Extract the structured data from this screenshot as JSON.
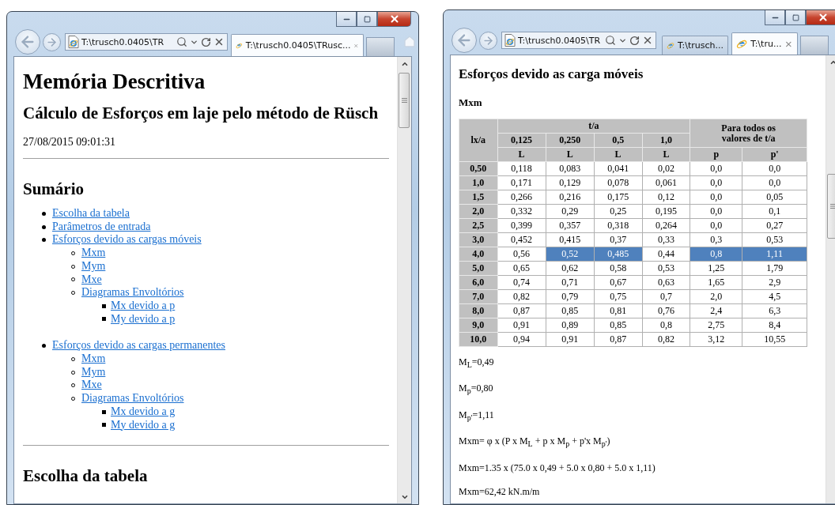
{
  "left_window": {
    "address": "T:\\trusch0.0405\\TR",
    "tabs": [
      {
        "label": "T:\\trusch0.0405\\TRusc...",
        "selected": true
      }
    ],
    "page": {
      "title": "Memória Descritiva",
      "subtitle": "Cálculo de Esforços em laje pelo método de Rüsch",
      "timestamp": "27/08/2015 09:01:31",
      "summary_heading": "Sumário",
      "summary": [
        {
          "label": "Escolha da tabela"
        },
        {
          "label": "Parâmetros de entrada"
        },
        {
          "label": "Esforços devido as cargas móveis",
          "children": [
            {
              "label": "Mxm"
            },
            {
              "label": "Mym"
            },
            {
              "label": "Mxe"
            },
            {
              "label": "Diagramas Envoltórios",
              "children": [
                {
                  "label": "Mx devido a p"
                },
                {
                  "label": "My devido a p"
                }
              ]
            }
          ]
        },
        {
          "label": "Esforços devido as cargas permanentes",
          "children": [
            {
              "label": "Mxm"
            },
            {
              "label": "Mym"
            },
            {
              "label": "Mxe"
            },
            {
              "label": "Diagramas Envoltórios",
              "children": [
                {
                  "label": "Mx devido a g"
                },
                {
                  "label": "My devido a g"
                }
              ]
            }
          ]
        }
      ],
      "next_heading": "Escolha da tabela"
    }
  },
  "right_window": {
    "address": "T:\\trusch0.0405\\TR",
    "tabs": [
      {
        "label": "T:\\trusch...",
        "selected": false
      },
      {
        "label": "T:\\tru...",
        "selected": true
      }
    ],
    "page": {
      "heading": "Esforços devido as carga móveis",
      "subheading": "Mxm",
      "table": {
        "corner": "lx/a",
        "group": "t/a",
        "group_all": "Para todos os valores de t/a",
        "ta_values": [
          "0,125",
          "0,250",
          "0,5",
          "1,0"
        ],
        "units": [
          "L",
          "L",
          "L",
          "L",
          "p",
          "p'"
        ],
        "rows": [
          {
            "label": "0,50",
            "cells": [
              {
                "text": "0,118",
                "selected": false
              },
              {
                "text": "0,083",
                "selected": false
              },
              {
                "text": "0,041",
                "selected": false
              },
              {
                "text": "0,02",
                "selected": false
              },
              {
                "text": "0,0",
                "selected": false
              },
              {
                "text": "0,0",
                "selected": false
              }
            ]
          },
          {
            "label": "1,0",
            "cells": [
              {
                "text": "0,171",
                "selected": false
              },
              {
                "text": "0,129",
                "selected": false
              },
              {
                "text": "0,078",
                "selected": false
              },
              {
                "text": "0,061",
                "selected": false
              },
              {
                "text": "0,0",
                "selected": false
              },
              {
                "text": "0,0",
                "selected": false
              }
            ]
          },
          {
            "label": "1,5",
            "cells": [
              {
                "text": "0,266",
                "selected": false
              },
              {
                "text": "0,216",
                "selected": false
              },
              {
                "text": "0,175",
                "selected": false
              },
              {
                "text": "0,12",
                "selected": false
              },
              {
                "text": "0,0",
                "selected": false
              },
              {
                "text": "0,05",
                "selected": false
              }
            ]
          },
          {
            "label": "2,0",
            "cells": [
              {
                "text": "0,332",
                "selected": false
              },
              {
                "text": "0,29",
                "selected": false
              },
              {
                "text": "0,25",
                "selected": false
              },
              {
                "text": "0,195",
                "selected": false
              },
              {
                "text": "0,0",
                "selected": false
              },
              {
                "text": "0,1",
                "selected": false
              }
            ]
          },
          {
            "label": "2,5",
            "cells": [
              {
                "text": "0,399",
                "selected": false
              },
              {
                "text": "0,357",
                "selected": false
              },
              {
                "text": "0,318",
                "selected": false
              },
              {
                "text": "0,264",
                "selected": false
              },
              {
                "text": "0,0",
                "selected": false
              },
              {
                "text": "0,27",
                "selected": false
              }
            ]
          },
          {
            "label": "3,0",
            "cells": [
              {
                "text": "0,452",
                "selected": false
              },
              {
                "text": "0,415",
                "selected": false
              },
              {
                "text": "0,37",
                "selected": false
              },
              {
                "text": "0,33",
                "selected": false
              },
              {
                "text": "0,3",
                "selected": false
              },
              {
                "text": "0,53",
                "selected": false
              }
            ]
          },
          {
            "label": "4,0",
            "cells": [
              {
                "text": "0,56",
                "selected": false
              },
              {
                "text": "0,52",
                "selected": true
              },
              {
                "text": "0,485",
                "selected": true
              },
              {
                "text": "0,44",
                "selected": false
              },
              {
                "text": "0,8",
                "selected": true
              },
              {
                "text": "1,11",
                "selected": true
              }
            ]
          },
          {
            "label": "5,0",
            "cells": [
              {
                "text": "0,65",
                "selected": false
              },
              {
                "text": "0,62",
                "selected": false
              },
              {
                "text": "0,58",
                "selected": false
              },
              {
                "text": "0,53",
                "selected": false
              },
              {
                "text": "1,25",
                "selected": false
              },
              {
                "text": "1,79",
                "selected": false
              }
            ]
          },
          {
            "label": "6,0",
            "cells": [
              {
                "text": "0,74",
                "selected": false
              },
              {
                "text": "0,71",
                "selected": false
              },
              {
                "text": "0,67",
                "selected": false
              },
              {
                "text": "0,63",
                "selected": false
              },
              {
                "text": "1,65",
                "selected": false
              },
              {
                "text": "2,9",
                "selected": false
              }
            ]
          },
          {
            "label": "7,0",
            "cells": [
              {
                "text": "0,82",
                "selected": false
              },
              {
                "text": "0,79",
                "selected": false
              },
              {
                "text": "0,75",
                "selected": false
              },
              {
                "text": "0,7",
                "selected": false
              },
              {
                "text": "2,0",
                "selected": false
              },
              {
                "text": "4,5",
                "selected": false
              }
            ]
          },
          {
            "label": "8,0",
            "cells": [
              {
                "text": "0,87",
                "selected": false
              },
              {
                "text": "0,85",
                "selected": false
              },
              {
                "text": "0,81",
                "selected": false
              },
              {
                "text": "0,76",
                "selected": false
              },
              {
                "text": "2,4",
                "selected": false
              },
              {
                "text": "6,3",
                "selected": false
              }
            ]
          },
          {
            "label": "9,0",
            "cells": [
              {
                "text": "0,91",
                "selected": false
              },
              {
                "text": "0,89",
                "selected": false
              },
              {
                "text": "0,85",
                "selected": false
              },
              {
                "text": "0,8",
                "selected": false
              },
              {
                "text": "2,75",
                "selected": false
              },
              {
                "text": "8,4",
                "selected": false
              }
            ]
          },
          {
            "label": "10,0",
            "cells": [
              {
                "text": "0,94",
                "selected": false
              },
              {
                "text": "0,91",
                "selected": false
              },
              {
                "text": "0,87",
                "selected": false
              },
              {
                "text": "0,82",
                "selected": false
              },
              {
                "text": "3,12",
                "selected": false
              },
              {
                "text": "10,55",
                "selected": false
              }
            ]
          }
        ]
      },
      "formulas": [
        "M$_{L}$=0,49",
        "M$_{p}$=0,80",
        "M$_{p'}$=1,11",
        "Mxm= φ x (P x M$_{L}$ + p x M$_{p}$ + p'x M$_{p'}$)",
        "Mxm=1.35 x (75.0 x 0,49 + 5.0 x 0,80 + 5.0 x 1,11)",
        "Mxm=62,42 kN.m/m"
      ]
    }
  }
}
